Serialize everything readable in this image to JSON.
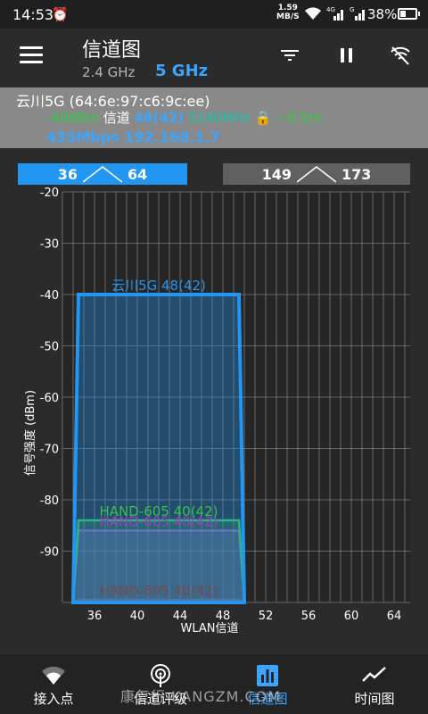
{
  "status": {
    "time": "14:53",
    "net_speed_value": "1.59",
    "net_speed_unit": "MB/S",
    "battery": "38%",
    "battery_level": 0.38
  },
  "toolbar": {
    "title": "信道图",
    "band_24": "2.4 GHz",
    "band_5": "5 GHz",
    "selected_band": "5 GHz"
  },
  "info": {
    "ssid_line": "云川5G (64:6e:97:c6:9c:ee)",
    "signal": "-40dBm",
    "channel_label": "信道",
    "channel": "48(42)",
    "frequency": "5240MHz",
    "distance": "~0.5m",
    "speed_ip": "433Mbps 192.168.1.7"
  },
  "ranges": [
    {
      "from": "36",
      "to": "64",
      "selected": true
    },
    {
      "from": "149",
      "to": "173",
      "selected": false
    }
  ],
  "chart_data": {
    "type": "area",
    "xlabel": "WLAN信道",
    "ylabel": "信号强度 (dBm)",
    "x_ticks": [
      "36",
      "40",
      "44",
      "48",
      "52",
      "56",
      "60",
      "64"
    ],
    "y_ticks": [
      "-20",
      "-30",
      "-40",
      "-50",
      "-60",
      "-70",
      "-80",
      "-90"
    ],
    "xlim": [
      33,
      65.5
    ],
    "ylim": [
      -100,
      -20
    ],
    "grid": true,
    "networks": [
      {
        "label": "云川5G 48(42)",
        "color": "#2196f3",
        "fill": "rgba(33,150,243,0.35)",
        "ch_start": 34,
        "ch_end": 50,
        "top_start": 34.5,
        "top_end": 49.5,
        "dbm": -40,
        "label_anchor_ch": 42
      },
      {
        "label": "HAND-605 40(42)",
        "color": "#36c24a",
        "fill": "rgba(54,194,74,0.25)",
        "ch_start": 34,
        "ch_end": 50,
        "top_start": 34.5,
        "top_end": 49.5,
        "dbm": -84,
        "label_anchor_ch": 42
      },
      {
        "label": "HAND-605 40(42)",
        "color": "#a040c0",
        "fill": "rgba(150,60,190,0.35)",
        "ch_start": 34,
        "ch_end": 50,
        "top_start": 34.5,
        "top_end": 49.5,
        "dbm": -86,
        "label_anchor_ch": 42
      },
      {
        "label": "HAND-605 40(42)",
        "color": "#7a4a4a",
        "fill": "rgba(0,0,0,0)",
        "ch_start": 34,
        "ch_end": 50,
        "top_start": 34.5,
        "top_end": 49.5,
        "dbm": -99.5,
        "label_anchor_ch": 42
      }
    ]
  },
  "nav": [
    {
      "label": "接入点",
      "icon": "wifi-icon",
      "active": false
    },
    {
      "label": "信道评级",
      "icon": "radar-icon",
      "active": false
    },
    {
      "label": "信道图",
      "icon": "bar-chart-icon",
      "active": true
    },
    {
      "label": "时间图",
      "icon": "line-chart-icon",
      "active": false
    }
  ],
  "watermark": "康复行 KANGZM.COM"
}
